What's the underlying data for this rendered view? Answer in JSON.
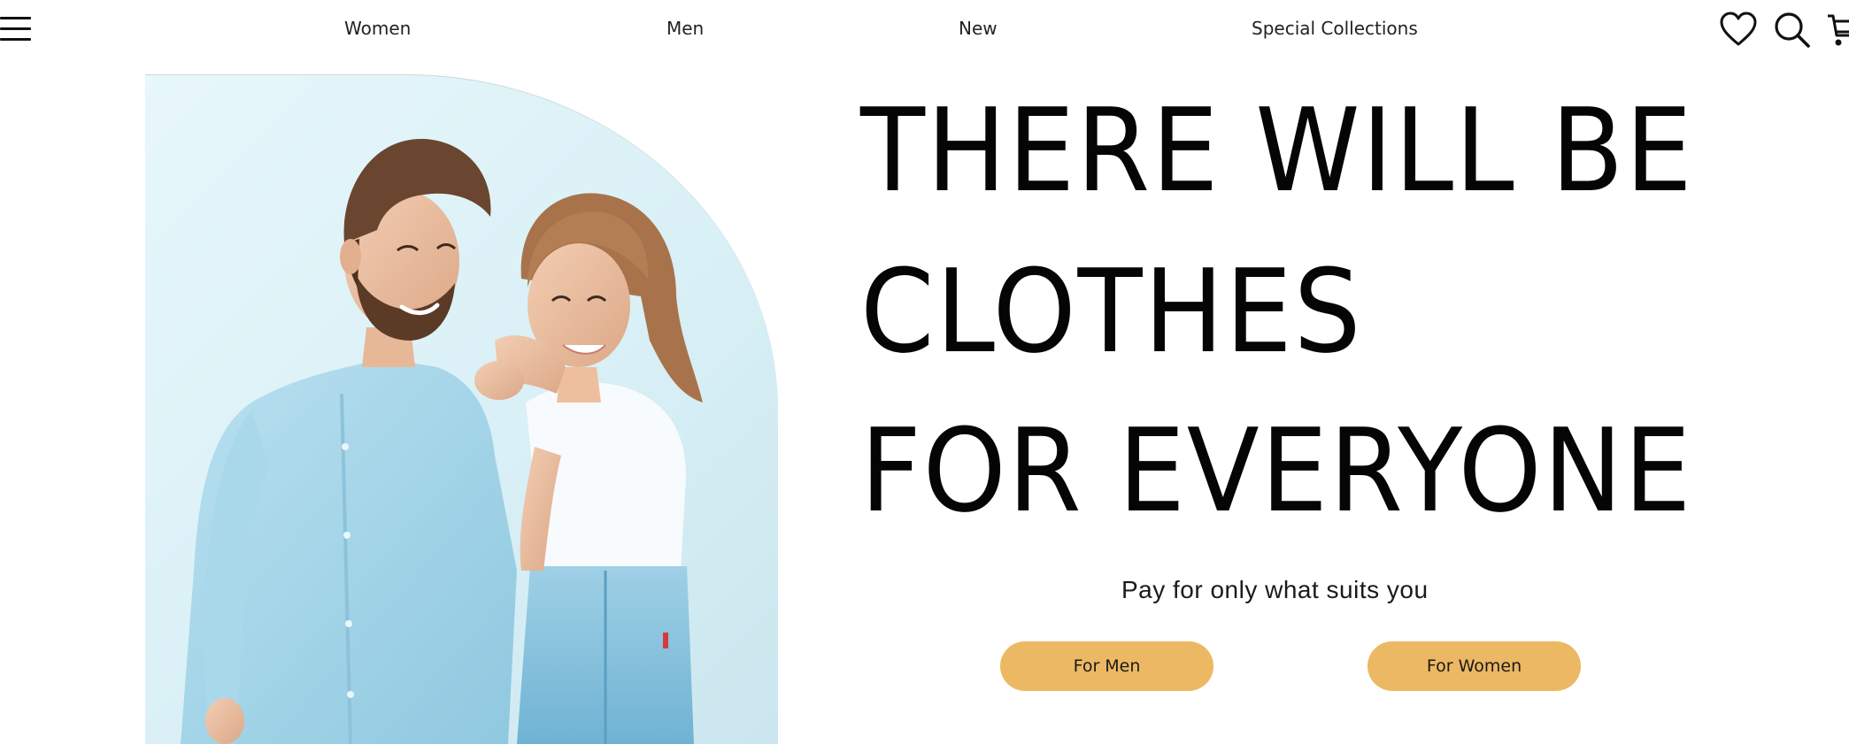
{
  "header": {
    "menu_icon": "hamburger-menu-icon",
    "nav": [
      {
        "label": "Women"
      },
      {
        "label": "Men"
      },
      {
        "label": "New"
      },
      {
        "label": "Special Collections"
      }
    ],
    "icons": [
      "heart-icon",
      "search-icon",
      "cart-icon"
    ]
  },
  "hero": {
    "image": "couple-photo",
    "headline": [
      "THERE WILL BE",
      "CLOTHES",
      "FOR EVERYONE"
    ],
    "tagline": "Pay for only what suits you",
    "buttons": {
      "men": "For Men",
      "women": "For Women"
    }
  },
  "colors": {
    "accent": "#ecb863",
    "text": "#050505",
    "background": "#ffffff"
  }
}
